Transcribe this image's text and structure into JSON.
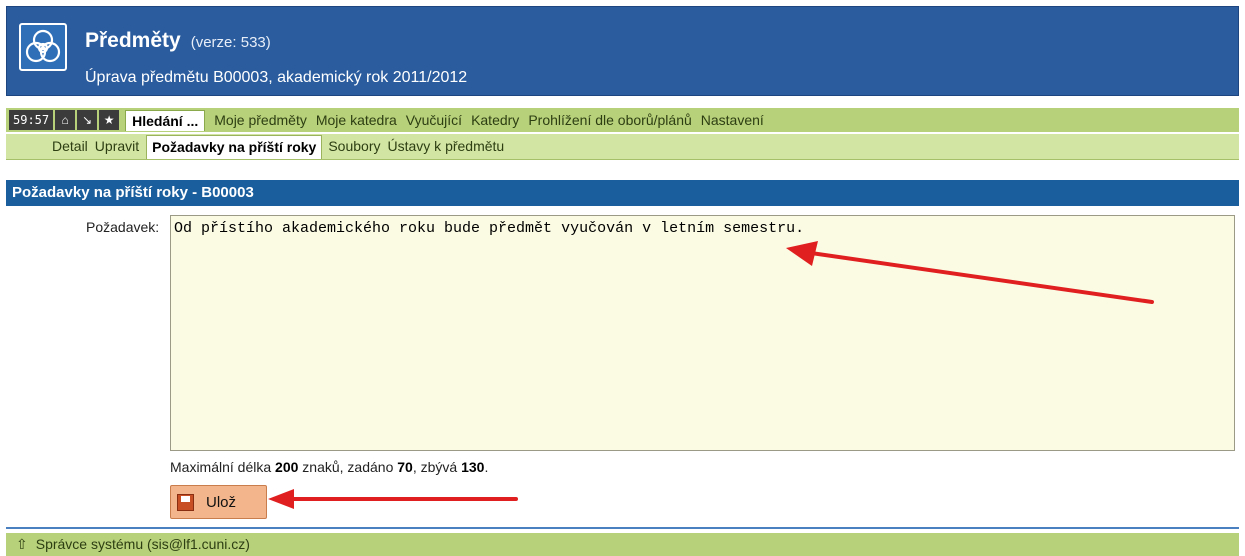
{
  "header": {
    "title": "Předměty",
    "version": "(verze: 533)",
    "subtitle": "Úprava předmětu B00003, akademický rok 2011/2012"
  },
  "main_nav": {
    "timer": "59:57",
    "icons": [
      "home-icon",
      "exit-icon",
      "star-icon"
    ],
    "items": [
      {
        "label": "Hledání ..."
      },
      {
        "label": "Moje předměty"
      },
      {
        "label": "Moje katedra"
      },
      {
        "label": "Vyučující"
      },
      {
        "label": "Katedry"
      },
      {
        "label": "Prohlížení dle oborů/plánů"
      },
      {
        "label": "Nastavení"
      }
    ]
  },
  "sub_nav": {
    "items": [
      {
        "label": "Detail"
      },
      {
        "label": "Upravit"
      },
      {
        "label": "Požadavky na příští roky"
      },
      {
        "label": "Soubory"
      },
      {
        "label": "Ústavy k předmětu"
      }
    ]
  },
  "section": {
    "title": "Požadavky na příští roky - B00003"
  },
  "form": {
    "field_label": "Požadavek:",
    "field_value": "Od přístího akademického roku bude předmět vyučován v letním semestru.",
    "counter": {
      "prefix": "Maximální délka",
      "max": "200",
      "mid1": "znaků, zadáno",
      "entered": "70",
      "mid2": ", zbývá",
      "remaining": "130",
      "suffix": "."
    },
    "save_label": "Ulož"
  },
  "footer": {
    "admin": "Správce systému (sis@lf1.cuni.cz)"
  },
  "colors": {
    "header": "#2a5c9e",
    "nav": "#b7d07a",
    "section": "#1a5e9e",
    "arrow": "#e02020",
    "save": "#f2b58c"
  }
}
